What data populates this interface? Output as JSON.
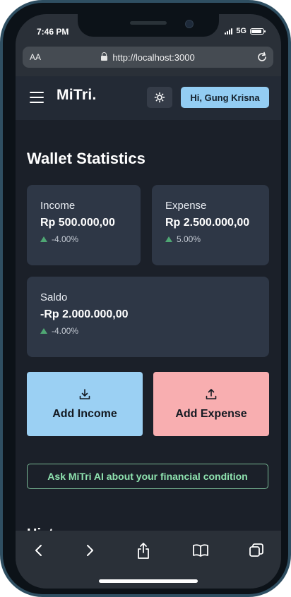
{
  "status_bar": {
    "time": "7:46 PM",
    "network": "5G"
  },
  "browser": {
    "aa_label": "AA",
    "url": "http://localhost:3000"
  },
  "header": {
    "logo": "MiTri.",
    "greeting": "Hi, Gung Krisna"
  },
  "page": {
    "title": "Wallet Statistics"
  },
  "stats": {
    "income": {
      "label": "Income",
      "value": "Rp 500.000,00",
      "change": "-4.00%"
    },
    "expense": {
      "label": "Expense",
      "value": "Rp 2.500.000,00",
      "change": "5.00%"
    },
    "saldo": {
      "label": "Saldo",
      "value": "-Rp 2.000.000,00",
      "change": "-4.00%"
    }
  },
  "actions": {
    "add_income": "Add Income",
    "add_expense": "Add Expense",
    "ask_ai": "Ask MiTri AI about your financial condition"
  },
  "history": {
    "title": "Hist"
  },
  "colors": {
    "accent_blue": "#93cdf3",
    "income_button": "#9bd0f3",
    "expense_button": "#f8aeb0",
    "ai_border": "#79b895",
    "up_indicator": "#4fa774"
  }
}
